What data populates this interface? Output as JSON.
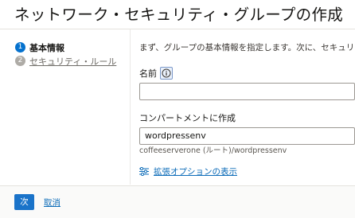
{
  "page": {
    "title": "ネットワーク・セキュリティ・グループの作成"
  },
  "steps": [
    {
      "number": "1",
      "label": "基本情報",
      "state": "active"
    },
    {
      "number": "2",
      "label": "セキュリティ・ルール",
      "state": "inactive"
    }
  ],
  "form": {
    "intro": "まず、グループの基本情報を指定します。次に、セキュリティ",
    "name_label": "名前",
    "name_value": "",
    "compartment_label": "コンパートメントに作成",
    "compartment_value": "wordpressenv",
    "compartment_path": "coffeeserverone (ルート)/wordpressenv",
    "advanced_link": "拡張オプションの表示"
  },
  "footer": {
    "next_label": "次",
    "cancel_label": "取消"
  },
  "colors": {
    "accent": "#0572ce",
    "link": "#0b6bb8",
    "step_inactive": "#aeaba6"
  }
}
